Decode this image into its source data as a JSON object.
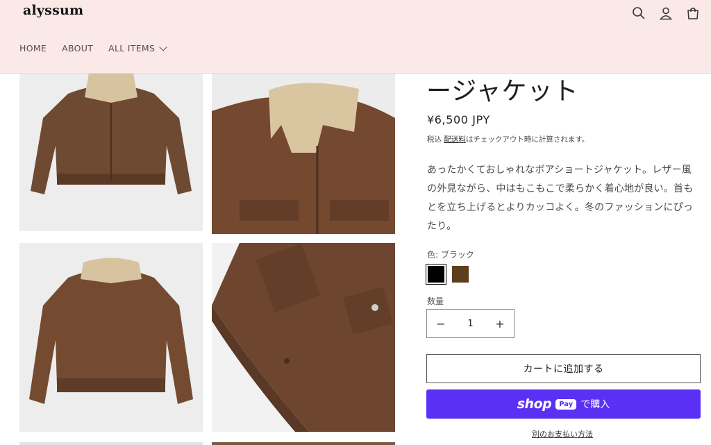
{
  "header": {
    "logo": "alyssum",
    "nav": [
      {
        "label": "HOME"
      },
      {
        "label": "ABOUT"
      },
      {
        "label": "ALL ITEMS"
      }
    ],
    "icons": [
      "search-icon",
      "account-icon",
      "cart-icon"
    ]
  },
  "product": {
    "title": "ージャケット",
    "price": "¥6,500 JPY",
    "tax_prefix": "税込 ",
    "tax_link": "配送料",
    "tax_suffix": "はチェックアウト時に計算されます。",
    "description": "あったかくておしゃれなボアショートジャケット。レザー風の外見ながら、中はもこもこで柔らかく着心地が良い。首もとを立ち上げるとよりカッコよく。冬のファッションにぴったり。",
    "color_label": "色: ブラック",
    "swatches": [
      {
        "name": "ブラック",
        "color": "#000000"
      },
      {
        "name": "ブラウン",
        "color": "#5e3e1c"
      }
    ],
    "qty_label": "数量",
    "qty_value": "1",
    "qty_minus": "−",
    "qty_plus": "+",
    "add_to_cart": "カートに追加する",
    "shop_pay_word": "shop",
    "shop_pay_pill": "Pay",
    "shop_pay_buy": "で購入",
    "other_payment": "別のお支払い方法"
  },
  "colors": {
    "header_bg": "#fbe9e8",
    "accent": "#5a31f4",
    "leather": "#7a4f33",
    "collar": "#dcc7a3"
  }
}
